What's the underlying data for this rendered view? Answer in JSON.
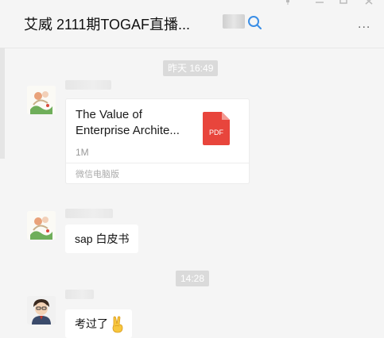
{
  "header": {
    "title": "艾威 2111期TOGAF直播...",
    "more_label": "..."
  },
  "icons": {
    "more": "more-icon",
    "search": "search-icon",
    "pdf": "pdf-file-icon",
    "emoji": "victory-hand-emoji"
  },
  "messages": {
    "stamp_1": "昨天 16:49",
    "file": {
      "name_line1": "The Value of",
      "name_line2": "Enterprise Archite...",
      "size": "1M",
      "source": "微信电脑版",
      "type_label": "PDF"
    },
    "text_1": "sap 白皮书",
    "stamp_2": "14:28",
    "text_2": "考过了"
  },
  "colors": {
    "background": "#f5f5f5",
    "bubble": "#ffffff",
    "pdf_red": "#e8453c",
    "stamp_bg": "#dadada"
  }
}
